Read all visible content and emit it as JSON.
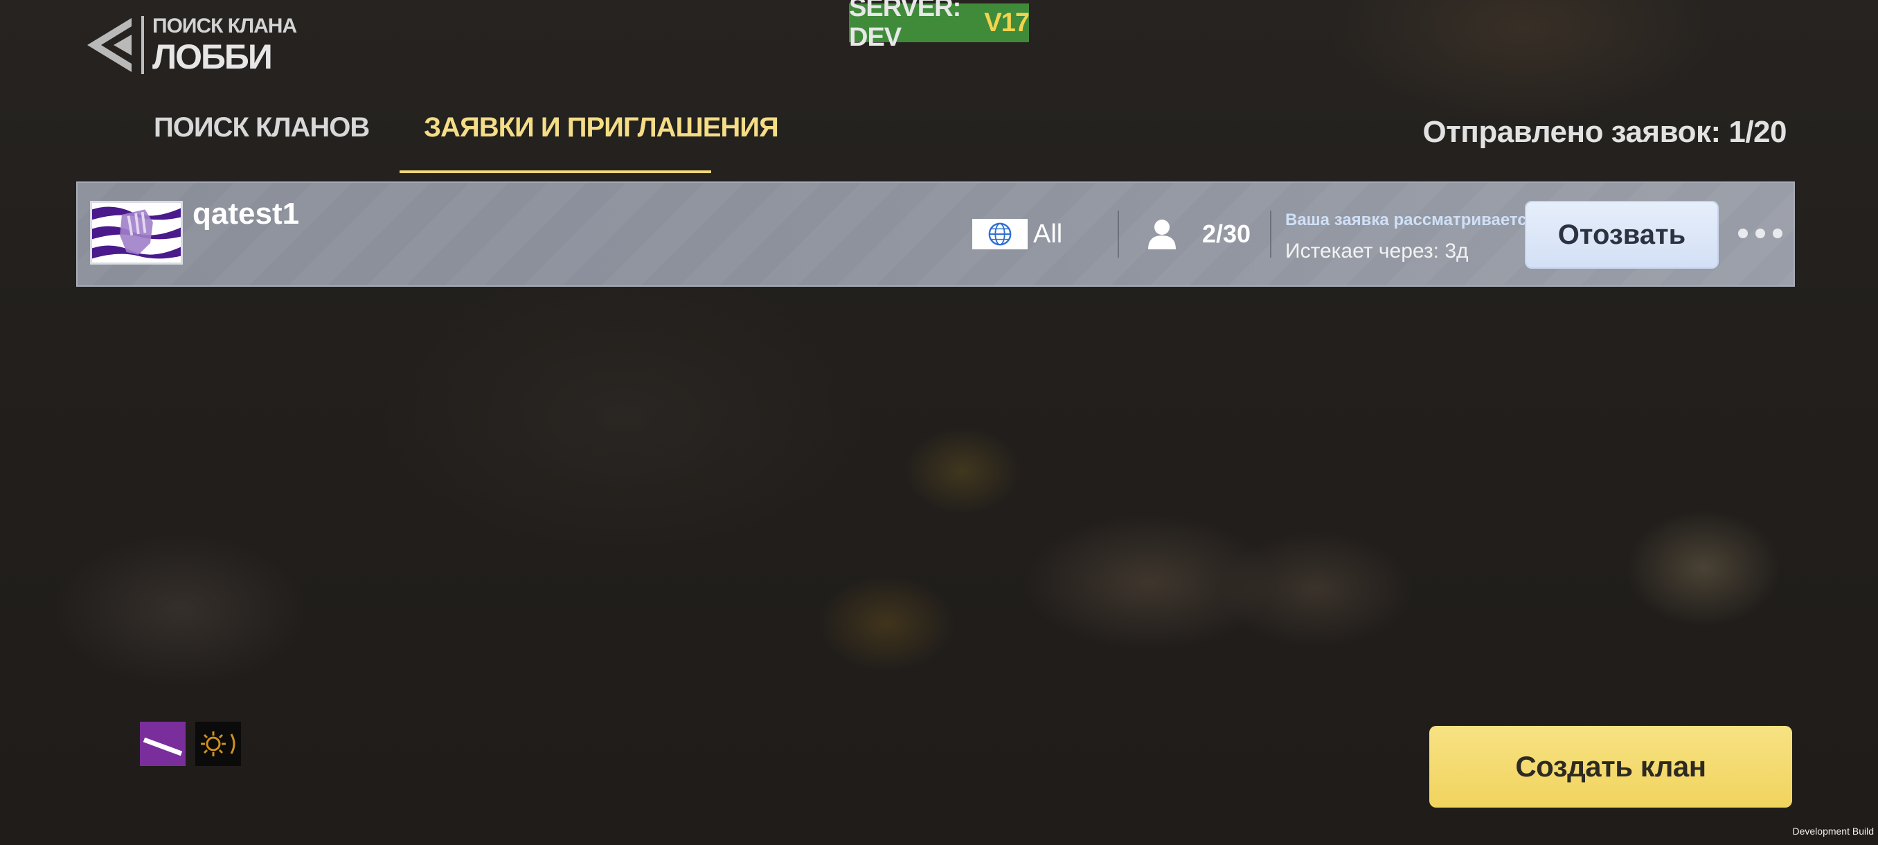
{
  "header": {
    "subtitle": "ПОИСК КЛАНА",
    "title": "ЛОББИ",
    "back_icon": "back-arrow-icon"
  },
  "server": {
    "label": "SERVER: DEV",
    "version": "V17",
    "bg_color": "#3f8b3a",
    "version_color": "#f2d44e"
  },
  "tabs": [
    {
      "label": "ПОИСК КЛАНОВ",
      "active": false
    },
    {
      "label": "ЗАЯВКИ И ПРИГЛАШЕНИЯ",
      "active": true
    }
  ],
  "sent_requests": "Отправлено заявок: 1/20",
  "clan_rows": [
    {
      "name": "qatest1",
      "region": "All",
      "region_icon": "globe-icon",
      "members": "2/30",
      "members_icon": "person-icon",
      "status": "Ваша заявка рассматривается",
      "expires": "Истекает через: 3д",
      "withdraw_label": "Отозвать",
      "more_icon": "more-dots-icon"
    }
  ],
  "create_clan_label": "Создать клан",
  "dev_build": "Development Build",
  "colors": {
    "accent_yellow": "#f0d77a",
    "row_bg": "#8d919c",
    "withdraw_bg": "#dde7f8",
    "create_bg": "#f3d86a"
  }
}
